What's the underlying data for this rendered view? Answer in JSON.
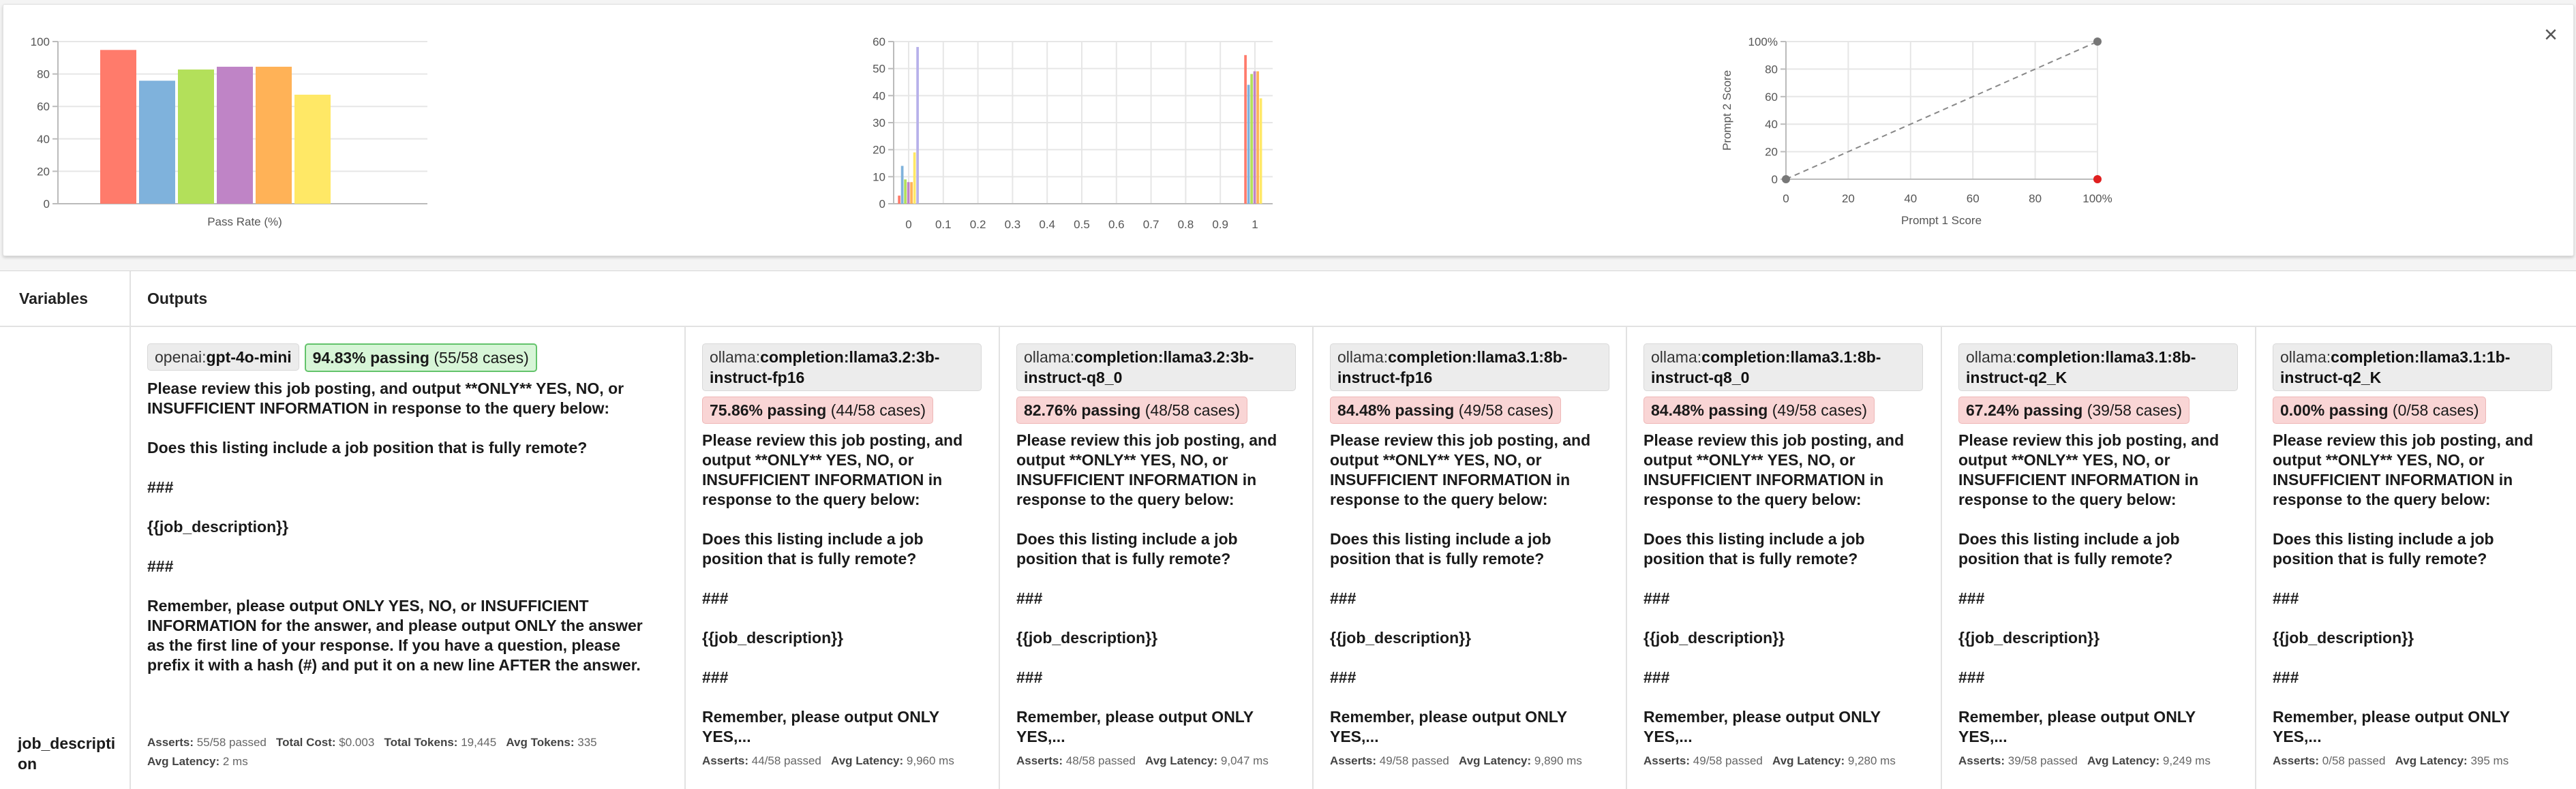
{
  "charts": {
    "close_label": "×",
    "chart_data": [
      {
        "type": "bar",
        "title": "",
        "xlabel": "Pass Rate (%)",
        "ylabel": "",
        "ylim": [
          0,
          100
        ],
        "yticks": [
          "0",
          "20",
          "40",
          "60",
          "80",
          "100"
        ],
        "categories": [
          "openai:gpt-4o-mini",
          "ollama:completion:llama3.2:3b-instruct-fp16",
          "ollama:completion:llama3.2:3b-instruct-q8_0",
          "ollama:completion:llama3.1:8b-instruct-fp16",
          "ollama:completion:llama3.1:8b-instruct-q8_0",
          "ollama:completion:llama3.1:8b-instruct-q2_K"
        ],
        "values": [
          94.83,
          75.86,
          82.76,
          84.48,
          84.48,
          67.24
        ],
        "colors": [
          "#ff7b6b",
          "#7fb2dc",
          "#b3e05a",
          "#bf84c6",
          "#ffb257",
          "#ffe866"
        ],
        "grid": true
      },
      {
        "type": "bar",
        "title": "",
        "xlabel": "",
        "ylabel": "",
        "ylim": [
          0,
          60
        ],
        "yticks": [
          "0",
          "10",
          "20",
          "30",
          "40",
          "50",
          "60"
        ],
        "xticks": [
          "0",
          "0.1",
          "0.2",
          "0.3",
          "0.4",
          "0.5",
          "0.6",
          "0.7",
          "0.8",
          "0.9",
          "1"
        ],
        "bins": [
          {
            "x": 0,
            "values": [
              3,
              14,
              9,
              8,
              8,
              19,
              58
            ]
          },
          {
            "x": 1,
            "values": [
              55,
              44,
              48,
              49,
              49,
              39,
              0
            ]
          }
        ],
        "colors": [
          "#ff7b6b",
          "#7fb2dc",
          "#b3e05a",
          "#bf84c6",
          "#ffb257",
          "#ffe866",
          "#b7b0ea"
        ],
        "grid": true
      },
      {
        "type": "scatter",
        "title": "",
        "xlabel": "Prompt 1 Score",
        "ylabel": "Prompt 2 Score",
        "xlim": [
          0,
          100
        ],
        "ylim": [
          0,
          100
        ],
        "xticks": [
          "0",
          "20",
          "40",
          "60",
          "80",
          "100%"
        ],
        "yticks": [
          "0",
          "20",
          "40",
          "60",
          "80",
          "100%"
        ],
        "points": [
          {
            "x": 0,
            "y": 0,
            "color": "#777777"
          },
          {
            "x": 100,
            "y": 100,
            "color": "#777777"
          },
          {
            "x": 100,
            "y": 0,
            "color": "#e02020"
          }
        ],
        "diagonal": true,
        "grid": true
      }
    ]
  },
  "table": {
    "col_variables": "Variables",
    "col_outputs": "Outputs",
    "var_name": "job_description",
    "outputs": [
      {
        "provider_prefix": "openai:",
        "provider_model": "gpt-4o-mini",
        "pass_pct": "94.83% passing",
        "pass_count": "(55/58 cases)",
        "good": true,
        "prompt": "Please review this job posting, and output **ONLY** YES, NO, or INSUFFICIENT INFORMATION in response to the query below:\n\nDoes this listing include a job position that is fully remote?\n\n###\n\n{{job_description}}\n\n###\n\nRemember, please output ONLY YES, NO, or INSUFFICIENT INFORMATION for the answer, and please output ONLY the answer as the first line of your response. If you have a question, please prefix it with a hash (#) and put it on a new line AFTER the answer.",
        "asserts_label": "Asserts:",
        "asserts": "55/58 passed",
        "cost_label": "Total Cost:",
        "cost": "$0.003",
        "tokens_label": "Total Tokens:",
        "tokens": "19,445",
        "avg_tokens_label": "Avg Tokens:",
        "avg_tokens": "335",
        "latency_label": "Avg Latency:",
        "latency": "2 ms"
      },
      {
        "provider_prefix": "ollama:",
        "provider_model": "completion:llama3.2:3b-instruct-fp16",
        "pass_pct": "75.86% passing",
        "pass_count": "(44/58 cases)",
        "good": false,
        "prompt": "Please review this job posting, and output **ONLY** YES, NO, or INSUFFICIENT INFORMATION in response to the query below:\n\nDoes this listing include a job position that is fully remote?\n\n###\n\n{{job_description}}\n\n###\n\nRemember, please output ONLY YES,...",
        "asserts_label": "Asserts:",
        "asserts": "44/58 passed",
        "latency_label": "Avg Latency:",
        "latency": "9,960 ms"
      },
      {
        "provider_prefix": "ollama:",
        "provider_model": "completion:llama3.2:3b-instruct-q8_0",
        "pass_pct": "82.76% passing",
        "pass_count": "(48/58 cases)",
        "good": false,
        "prompt": "Please review this job posting, and output **ONLY** YES, NO, or INSUFFICIENT INFORMATION in response to the query below:\n\nDoes this listing include a job position that is fully remote?\n\n###\n\n{{job_description}}\n\n###\n\nRemember, please output ONLY YES,...",
        "asserts_label": "Asserts:",
        "asserts": "48/58 passed",
        "latency_label": "Avg Latency:",
        "latency": "9,047 ms"
      },
      {
        "provider_prefix": "ollama:",
        "provider_model": "completion:llama3.1:8b-instruct-fp16",
        "pass_pct": "84.48% passing",
        "pass_count": "(49/58 cases)",
        "good": false,
        "prompt": "Please review this job posting, and output **ONLY** YES, NO, or INSUFFICIENT INFORMATION in response to the query below:\n\nDoes this listing include a job position that is fully remote?\n\n###\n\n{{job_description}}\n\n###\n\nRemember, please output ONLY YES,...",
        "asserts_label": "Asserts:",
        "asserts": "49/58 passed",
        "latency_label": "Avg Latency:",
        "latency": "9,890 ms"
      },
      {
        "provider_prefix": "ollama:",
        "provider_model": "completion:llama3.1:8b-instruct-q8_0",
        "pass_pct": "84.48% passing",
        "pass_count": "(49/58 cases)",
        "good": false,
        "prompt": "Please review this job posting, and output **ONLY** YES, NO, or INSUFFICIENT INFORMATION in response to the query below:\n\nDoes this listing include a job position that is fully remote?\n\n###\n\n{{job_description}}\n\n###\n\nRemember, please output ONLY YES,...",
        "asserts_label": "Asserts:",
        "asserts": "49/58 passed",
        "latency_label": "Avg Latency:",
        "latency": "9,280 ms"
      },
      {
        "provider_prefix": "ollama:",
        "provider_model": "completion:llama3.1:8b-instruct-q2_K",
        "pass_pct": "67.24% passing",
        "pass_count": "(39/58 cases)",
        "good": false,
        "prompt": "Please review this job posting, and output **ONLY** YES, NO, or INSUFFICIENT INFORMATION in response to the query below:\n\nDoes this listing include a job position that is fully remote?\n\n###\n\n{{job_description}}\n\n###\n\nRemember, please output ONLY YES,...",
        "asserts_label": "Asserts:",
        "asserts": "39/58 passed",
        "latency_label": "Avg Latency:",
        "latency": "9,249 ms"
      },
      {
        "provider_prefix": "ollama:",
        "provider_model": "completion:llama3.1:1b-instruct-q2_K",
        "pass_pct": "0.00% passing",
        "pass_count": "(0/58 cases)",
        "good": false,
        "prompt": "Please review this job posting, and output **ONLY** YES, NO, or INSUFFICIENT INFORMATION in response to the query below:\n\nDoes this listing include a job position that is fully remote?\n\n###\n\n{{job_description}}\n\n###\n\nRemember, please output ONLY YES,...",
        "asserts_label": "Asserts:",
        "asserts": "0/58 passed",
        "latency_label": "Avg Latency:",
        "latency": "395 ms"
      }
    ]
  }
}
